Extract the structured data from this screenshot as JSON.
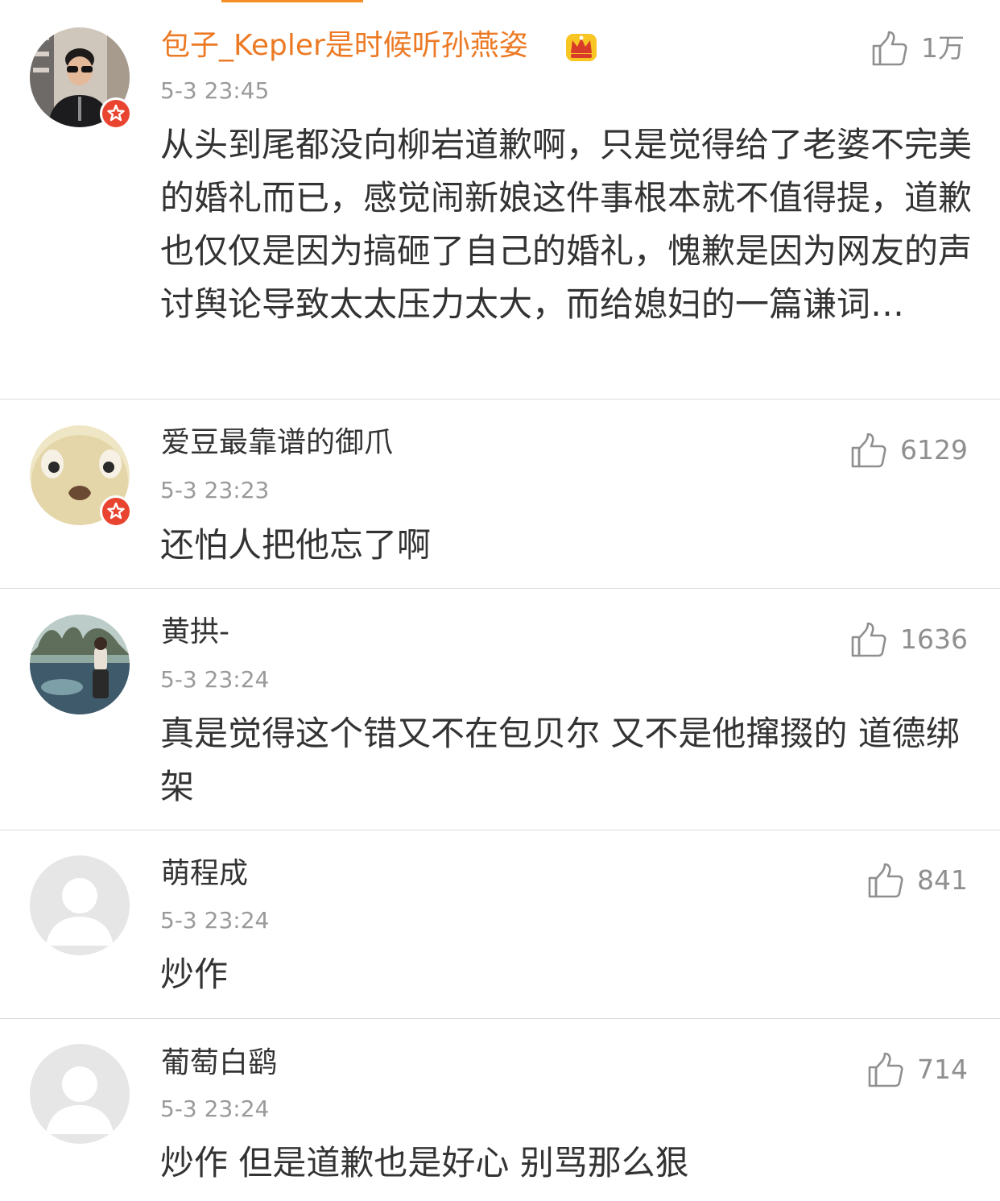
{
  "colors": {
    "accent": "#f38f26",
    "vip_name": "#ec7a25",
    "text": "#333333",
    "meta": "#9a9a9a",
    "verified_badge": "#e8442f",
    "divider": "#dcdcdc"
  },
  "icons": {
    "like": "thumbs-up-icon",
    "crown": "crown-icon",
    "verified": "verified-star-icon"
  },
  "comments": [
    {
      "username": "包子_Kepler是时候听孙燕姿",
      "time": "5-3 23:45",
      "text": "从头到尾都没向柳岩道歉啊，只是觉得给了老婆不完美的婚礼而已，感觉闹新娘这件事根本就不值得提，道歉也仅仅是因为搞砸了自己的婚礼，愧歉是因为网友的声讨舆论导致太太压力太大，而给媳妇的一篇谦词…",
      "likes": "1万"
    },
    {
      "username": "爱豆最靠谱的御爪",
      "time": "5-3 23:23",
      "text": "还怕人把他忘了啊",
      "likes": "6129"
    },
    {
      "username": "黄拱-",
      "time": "5-3 23:24",
      "text": "真是觉得这个错又不在包贝尔 又不是他撺掇的 道德绑架",
      "likes": "1636"
    },
    {
      "username": "萌程成",
      "time": "5-3 23:24",
      "text": "炒作",
      "likes": "841"
    },
    {
      "username": "葡萄白鹞",
      "time": "5-3 23:24",
      "text": "炒作 但是道歉也是好心 别骂那么狠",
      "likes": "714"
    }
  ]
}
